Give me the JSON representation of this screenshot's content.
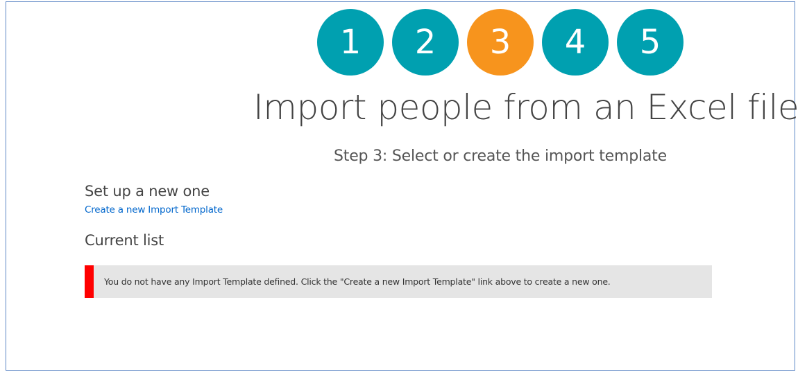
{
  "wizard": {
    "steps": [
      {
        "label": "1",
        "state": "default"
      },
      {
        "label": "2",
        "state": "default"
      },
      {
        "label": "3",
        "state": "active"
      },
      {
        "label": "4",
        "state": "default"
      },
      {
        "label": "5",
        "state": "default"
      }
    ],
    "colors": {
      "default": "#00a0b0",
      "active": "#f7941d"
    }
  },
  "page": {
    "title": "Import people from an Excel file",
    "subtitle": "Step 3: Select or create the import template"
  },
  "setup": {
    "heading": "Set up a new one",
    "link_label": "Create a new Import Template"
  },
  "current": {
    "heading": "Current list",
    "message": "You do not have any Import Template defined. Click the \"Create a new Import Template\" link above to create a new one.",
    "message_accent_color": "#ff0000"
  }
}
